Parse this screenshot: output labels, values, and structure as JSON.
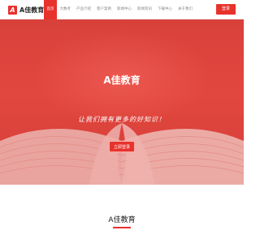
{
  "header": {
    "logo_mark": "A",
    "logo_text": "A佳教育",
    "nav": [
      "首页",
      "大数考",
      "产品介绍",
      "客户案例",
      "新闻中心",
      "新闻资讯",
      "下载中心",
      "关于我们"
    ],
    "login_label": "登录"
  },
  "hero": {
    "title": "A佳教育",
    "slogan": "让我们拥有更多的好知识！",
    "button_label": "立即登录"
  },
  "section": {
    "title": "A佳教育"
  },
  "colors": {
    "accent": "#e8322c",
    "hero_bg": "#e2473f"
  }
}
